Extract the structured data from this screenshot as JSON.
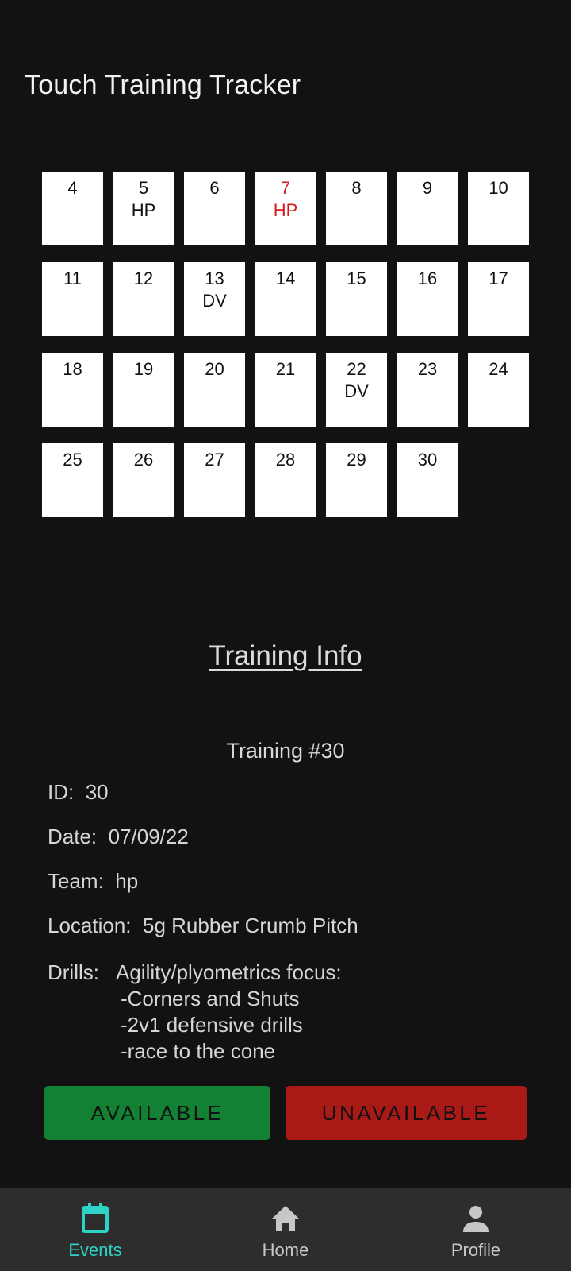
{
  "app": {
    "title": "Touch Training Tracker"
  },
  "calendar": {
    "days": [
      {
        "num": "4",
        "tag": ""
      },
      {
        "num": "5",
        "tag": "HP"
      },
      {
        "num": "6",
        "tag": ""
      },
      {
        "num": "7",
        "tag": "HP",
        "selected": true
      },
      {
        "num": "8",
        "tag": ""
      },
      {
        "num": "9",
        "tag": ""
      },
      {
        "num": "10",
        "tag": ""
      },
      {
        "num": "11",
        "tag": ""
      },
      {
        "num": "12",
        "tag": ""
      },
      {
        "num": "13",
        "tag": "DV"
      },
      {
        "num": "14",
        "tag": ""
      },
      {
        "num": "15",
        "tag": ""
      },
      {
        "num": "16",
        "tag": ""
      },
      {
        "num": "17",
        "tag": ""
      },
      {
        "num": "18",
        "tag": ""
      },
      {
        "num": "19",
        "tag": ""
      },
      {
        "num": "20",
        "tag": ""
      },
      {
        "num": "21",
        "tag": ""
      },
      {
        "num": "22",
        "tag": "DV"
      },
      {
        "num": "23",
        "tag": ""
      },
      {
        "num": "24",
        "tag": ""
      },
      {
        "num": "25",
        "tag": ""
      },
      {
        "num": "26",
        "tag": ""
      },
      {
        "num": "27",
        "tag": ""
      },
      {
        "num": "28",
        "tag": ""
      },
      {
        "num": "29",
        "tag": ""
      },
      {
        "num": "30",
        "tag": ""
      }
    ]
  },
  "training_info": {
    "section_title": "Training Info",
    "title": "Training #30",
    "id_label": "ID:",
    "id_value": "30",
    "date_label": "Date:",
    "date_value": "07/09/22",
    "team_label": "Team:",
    "team_value": "hp",
    "location_label": "Location:",
    "location_value": "5g Rubber Crumb Pitch",
    "drills_label": "Drills:",
    "drills_focus": "Agility/plyometrics focus:",
    "drills_items": [
      "-Corners and Shuts",
      "-2v1 defensive drills",
      "-race to the cone"
    ]
  },
  "actions": {
    "available_label": "AVAILABLE",
    "unavailable_label": "UNAVAILABLE"
  },
  "nav": {
    "events_label": "Events",
    "home_label": "Home",
    "profile_label": "Profile"
  },
  "colors": {
    "background": "#121212",
    "selected_day_text": "#d01f1f",
    "available": "#138134",
    "unavailable": "#a91a16",
    "nav_active": "#2ed3c6",
    "nav_bar": "#2d2d2d"
  },
  "icons": {
    "events": "calendar-icon",
    "home": "home-icon",
    "profile": "person-icon"
  }
}
